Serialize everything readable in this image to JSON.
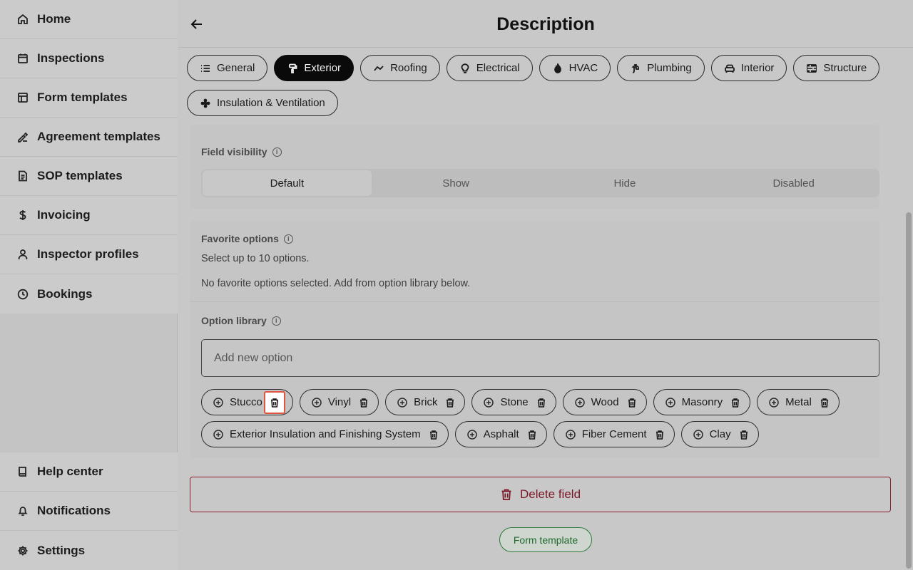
{
  "sidebar": {
    "top_items": [
      {
        "label": "Home",
        "icon": "home-icon"
      },
      {
        "label": "Inspections",
        "icon": "calendar-icon"
      },
      {
        "label": "Form templates",
        "icon": "layout-icon"
      },
      {
        "label": "Agreement templates",
        "icon": "signature-icon"
      },
      {
        "label": "SOP templates",
        "icon": "document-icon"
      },
      {
        "label": "Invoicing",
        "icon": "dollar-icon"
      },
      {
        "label": "Inspector profiles",
        "icon": "user-icon"
      },
      {
        "label": "Bookings",
        "icon": "clock-icon"
      }
    ],
    "bottom_items": [
      {
        "label": "Help center",
        "icon": "book-icon"
      },
      {
        "label": "Notifications",
        "icon": "bell-icon"
      },
      {
        "label": "Settings",
        "icon": "gear-icon"
      }
    ]
  },
  "header": {
    "title": "Description"
  },
  "tabs": [
    {
      "label": "General",
      "icon": "list-icon"
    },
    {
      "label": "Exterior",
      "icon": "paint-roller-icon",
      "active": true
    },
    {
      "label": "Roofing",
      "icon": "roof-icon"
    },
    {
      "label": "Electrical",
      "icon": "lightbulb-icon"
    },
    {
      "label": "HVAC",
      "icon": "flame-icon"
    },
    {
      "label": "Plumbing",
      "icon": "faucet-icon"
    },
    {
      "label": "Interior",
      "icon": "sofa-icon"
    },
    {
      "label": "Structure",
      "icon": "bricks-icon"
    },
    {
      "label": "Insulation & Ventilation",
      "icon": "fan-icon"
    }
  ],
  "field_visibility": {
    "label": "Field visibility",
    "options": [
      "Default",
      "Show",
      "Hide",
      "Disabled"
    ],
    "selected": "Default"
  },
  "favorite_options": {
    "label": "Favorite options",
    "hint": "Select up to 10 options.",
    "empty_text": "No favorite options selected. Add from option library below."
  },
  "option_library": {
    "label": "Option library",
    "input_placeholder": "Add new option",
    "options": [
      "Stucco",
      "Vinyl",
      "Brick",
      "Stone",
      "Wood",
      "Masonry",
      "Metal",
      "Exterior Insulation and Finishing System",
      "Asphalt",
      "Fiber Cement",
      "Clay"
    ]
  },
  "actions": {
    "delete_label": "Delete field",
    "form_template_label": "Form template"
  },
  "colors": {
    "danger": "#7a1626",
    "highlight": "#e0533f",
    "success": "#1f6a2c"
  }
}
